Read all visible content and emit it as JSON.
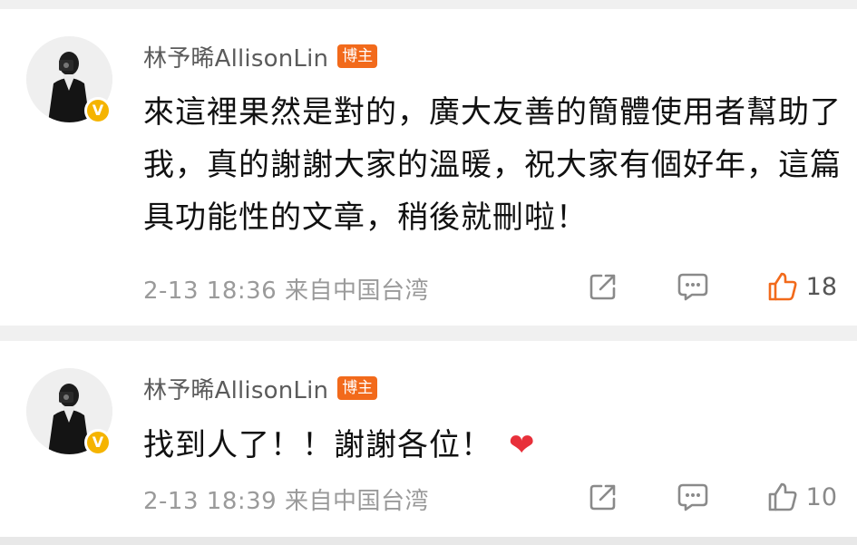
{
  "comments": [
    {
      "username": "林予晞AllisonLin",
      "badge": "博主",
      "verified_mark": "V",
      "text": "來這裡果然是對的，廣大友善的簡體使用者幫助了我，真的謝謝大家的溫暖，祝大家有個好年，這篇具功能性的文章，稍後就刪啦！",
      "meta": "2-13 18:36 来自中国台湾",
      "like_count": "18",
      "like_color": "#f26a1b",
      "icons": [
        "share-icon",
        "comment-icon",
        "like-icon"
      ]
    },
    {
      "username": "林予晞AllisonLin",
      "badge": "博主",
      "verified_mark": "V",
      "text": "找到人了！！謝謝各位！",
      "emoji": "❤",
      "meta": "2-13 18:39 来自中国台湾",
      "like_count": "10",
      "like_color": "#8a8a8a",
      "icons": [
        "share-icon",
        "comment-icon",
        "like-icon"
      ]
    }
  ]
}
